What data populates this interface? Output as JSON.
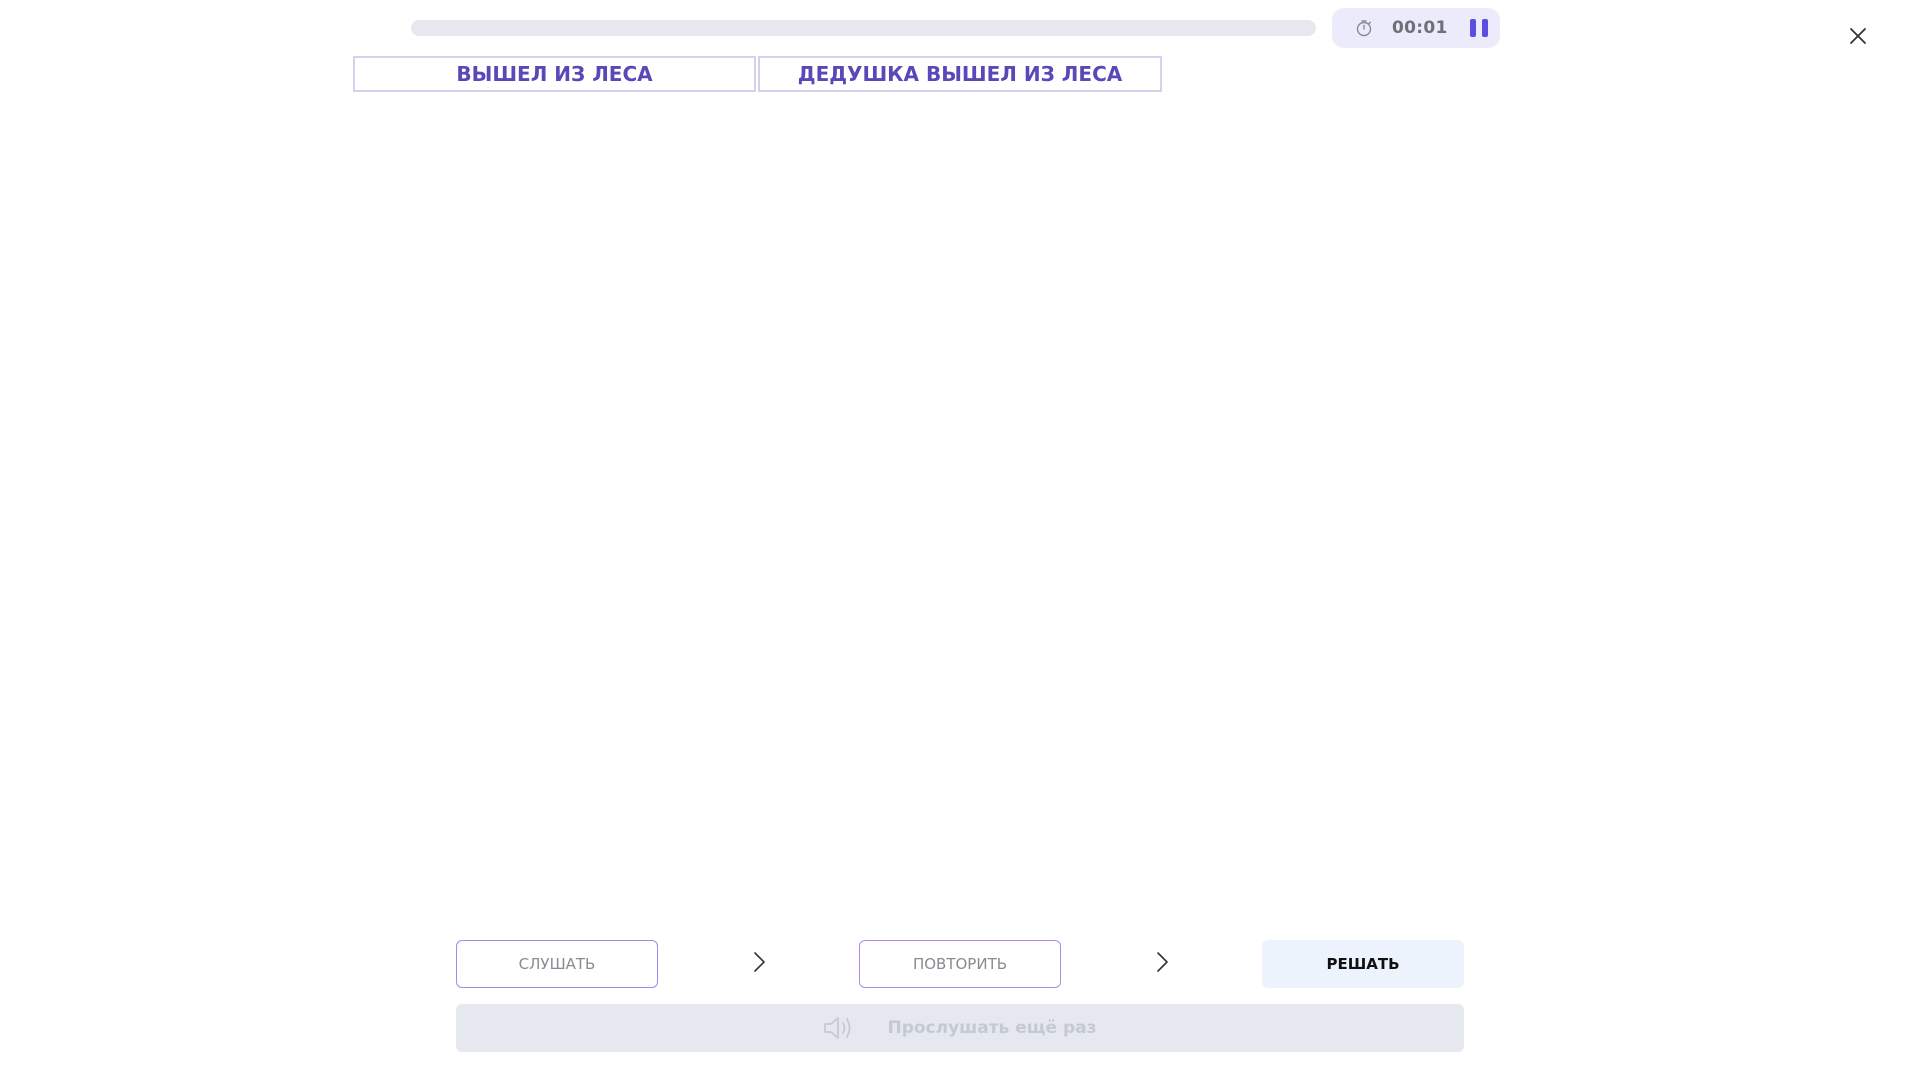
{
  "progress": {
    "value_percent": 0
  },
  "timer": {
    "time": "00:01",
    "stopwatch_icon": "stopwatch-icon",
    "pause_icon": "pause-icon"
  },
  "close_icon": "close-icon",
  "phrases": [
    {
      "text": "ВЫШЕЛ ИЗ ЛЕСА"
    },
    {
      "text": "ДЕДУШКА ВЫШЕЛ ИЗ ЛЕСА"
    }
  ],
  "steps": {
    "listen_label": "СЛУШАТЬ",
    "repeat_label": "ПОВТОРИТЬ",
    "solve_label": "РЕШАТЬ",
    "separator_icon": "chevron-right-icon"
  },
  "replay": {
    "label": "Прослушать ещё раз",
    "icon": "speaker-icon"
  },
  "colors": {
    "accent": "#5a4fe0",
    "phrase_text": "#5a47b8",
    "timer_bg": "#ecebfb",
    "solve_bg": "#edf3fc",
    "replay_bg": "#e5e8ee"
  }
}
